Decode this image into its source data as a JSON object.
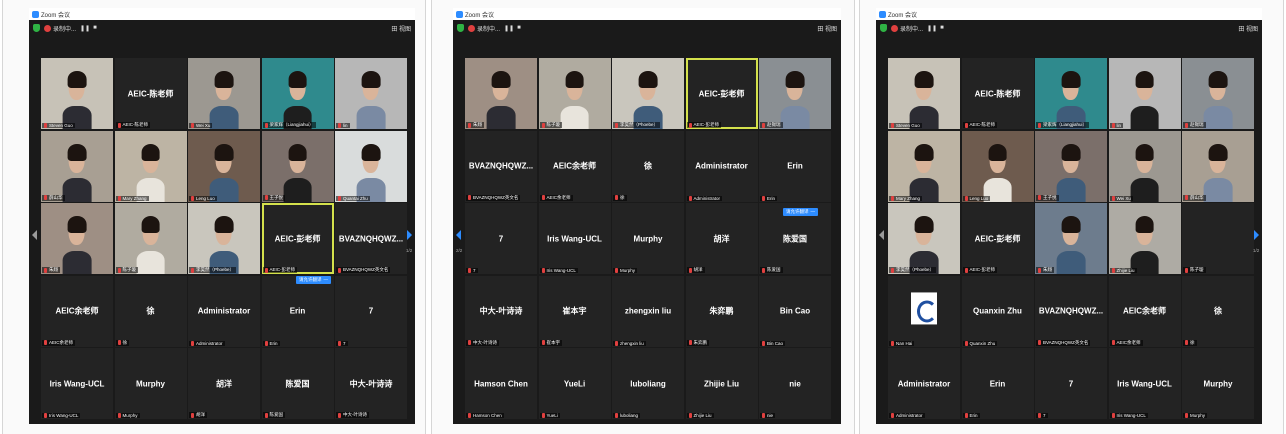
{
  "windows": [
    {
      "title": "Zoom 会议",
      "record_label": "录制中...",
      "view_label": "田 视图",
      "page": "1/2",
      "cc_label": "请允许翻译",
      "tiles": [
        {
          "kind": "video",
          "big": "",
          "label": "Steven Guo",
          "bg": "#c7c2b7"
        },
        {
          "kind": "name",
          "big": "AEIC-陈老师",
          "label": "AEIC-陈老师"
        },
        {
          "kind": "video",
          "big": "",
          "label": "Wei Xu",
          "bg": "#9c9891"
        },
        {
          "kind": "video",
          "big": "",
          "label": "梁家辉（Liangjiahui）",
          "bg": "#2f8a8d"
        },
        {
          "kind": "video",
          "big": "",
          "label": "lin",
          "bg": "#b7b7b7"
        },
        {
          "kind": "video",
          "big": "",
          "label": "薛山华",
          "bg": "#a89f93"
        },
        {
          "kind": "video",
          "big": "",
          "label": "Mary Zhang",
          "bg": "#bdb4a4"
        },
        {
          "kind": "video",
          "big": "",
          "label": "Leng Luo",
          "bg": "#6e5b4e"
        },
        {
          "kind": "video",
          "big": "",
          "label": "王子悦",
          "bg": "#7b6f6a"
        },
        {
          "kind": "video",
          "big": "",
          "label": "Quantai Zhu",
          "bg": "#d9dcdc"
        },
        {
          "kind": "video",
          "big": "",
          "label": "朱翔",
          "bg": "#9e8f84"
        },
        {
          "kind": "video",
          "big": "",
          "label": "陈子璇",
          "bg": "#b0aba0"
        },
        {
          "kind": "video",
          "big": "",
          "label": "李昊然（Phoebe）",
          "bg": "#c9c6bd"
        },
        {
          "kind": "name",
          "big": "AEIC-彭老师",
          "label": "AEIC-彭老师",
          "active": true
        },
        {
          "kind": "name",
          "big": "BVAZNQHQWZ...",
          "label": "BVAZNQHQWZ英文名"
        },
        {
          "kind": "name",
          "big": "AEIC余老师",
          "label": "AEIC余老师"
        },
        {
          "kind": "name",
          "big": "徐",
          "label": "徐"
        },
        {
          "kind": "name",
          "big": "Administrator",
          "label": "Administrator"
        },
        {
          "kind": "name",
          "big": "Erin",
          "label": "Erin"
        },
        {
          "kind": "name",
          "big": "7",
          "label": "7"
        },
        {
          "kind": "name",
          "big": "Iris Wang-UCL",
          "label": "Iris Wang-UCL"
        },
        {
          "kind": "name",
          "big": "Murphy",
          "label": "Murphy"
        },
        {
          "kind": "name",
          "big": "胡洋",
          "label": "胡洋"
        },
        {
          "kind": "name",
          "big": "陈爱国",
          "label": "陈爱国"
        },
        {
          "kind": "name",
          "big": "中大-叶诗诗",
          "label": "中大-叶诗诗"
        }
      ]
    },
    {
      "title": "Zoom 会议",
      "record_label": "录制中...",
      "view_label": "田 视图",
      "page": "2/2",
      "cc_label": "请允许翻译",
      "tiles": [
        {
          "kind": "video",
          "big": "",
          "label": "朱翔",
          "bg": "#9e8f84"
        },
        {
          "kind": "video",
          "big": "",
          "label": "陈子璇",
          "bg": "#b0aba0"
        },
        {
          "kind": "video",
          "big": "",
          "label": "李昊然（Phoebe）",
          "bg": "#c9c6bd"
        },
        {
          "kind": "name",
          "big": "AEIC-彭老师",
          "label": "AEIC-彭老师",
          "active": true
        },
        {
          "kind": "video",
          "big": "",
          "label": "赵锡瑞",
          "bg": "#8a8f93"
        },
        {
          "kind": "name",
          "big": "BVAZNQHQWZ...",
          "label": "BVAZNQHQWZ英文名"
        },
        {
          "kind": "name",
          "big": "AEIC余老师",
          "label": "AEIC余老师"
        },
        {
          "kind": "name",
          "big": "徐",
          "label": "徐"
        },
        {
          "kind": "name",
          "big": "Administrator",
          "label": "Administrator"
        },
        {
          "kind": "name",
          "big": "Erin",
          "label": "Erin"
        },
        {
          "kind": "name",
          "big": "7",
          "label": "7"
        },
        {
          "kind": "name",
          "big": "Iris Wang-UCL",
          "label": "Iris Wang-UCL"
        },
        {
          "kind": "name",
          "big": "Murphy",
          "label": "Murphy"
        },
        {
          "kind": "name",
          "big": "胡洋",
          "label": "胡洋"
        },
        {
          "kind": "name",
          "big": "陈爱国",
          "label": "陈爱国"
        },
        {
          "kind": "name",
          "big": "中大-叶诗诗",
          "label": "中大-叶诗诗"
        },
        {
          "kind": "name",
          "big": "崔本宇",
          "label": "崔本宇"
        },
        {
          "kind": "name",
          "big": "zhengxin liu",
          "label": "zhengxin liu"
        },
        {
          "kind": "name",
          "big": "朱弈鹏",
          "label": "朱弈鹏"
        },
        {
          "kind": "name",
          "big": "Bin Cao",
          "label": "Bin Cao"
        },
        {
          "kind": "name",
          "big": "Hamson Chen",
          "label": "Hamson Chen"
        },
        {
          "kind": "name",
          "big": "YueLi",
          "label": "YueLi"
        },
        {
          "kind": "name",
          "big": "luboliang",
          "label": "luboliang"
        },
        {
          "kind": "name",
          "big": "Zhijie Liu",
          "label": "Zhijie Liu"
        },
        {
          "kind": "name",
          "big": "nie",
          "label": "nie"
        }
      ]
    },
    {
      "title": "Zoom 会议",
      "record_label": "录制中...",
      "view_label": "田 视图",
      "page": "1/2",
      "cc_label": "",
      "tiles": [
        {
          "kind": "video",
          "big": "",
          "label": "Steven Guo",
          "bg": "#c7c2b7",
          "active": true
        },
        {
          "kind": "name",
          "big": "AEIC-陈老师",
          "label": "AEIC-陈老师"
        },
        {
          "kind": "video",
          "big": "",
          "label": "梁家辉（Liangjiahui）",
          "bg": "#2f8a8d"
        },
        {
          "kind": "video",
          "big": "",
          "label": "lin",
          "bg": "#b7b7b7"
        },
        {
          "kind": "video",
          "big": "",
          "label": "赵锡瑞",
          "bg": "#8a8f93"
        },
        {
          "kind": "video",
          "big": "",
          "label": "Mary Zhang",
          "bg": "#bdb4a4"
        },
        {
          "kind": "video",
          "big": "",
          "label": "Leng Luo",
          "bg": "#6e5b4e"
        },
        {
          "kind": "video",
          "big": "",
          "label": "王子悦",
          "bg": "#7b6f6a"
        },
        {
          "kind": "video",
          "big": "",
          "label": "Wei Xu",
          "bg": "#9c9891"
        },
        {
          "kind": "video",
          "big": "",
          "label": "薛山华",
          "bg": "#a89f93"
        },
        {
          "kind": "video",
          "big": "",
          "label": "李昊然（Phoebe）",
          "bg": "#c9c6bd"
        },
        {
          "kind": "name",
          "big": "AEIC-彭老师",
          "label": "AEIC-彭老师"
        },
        {
          "kind": "video",
          "big": "",
          "label": "朱翔",
          "bg": "#6d7c8d"
        },
        {
          "kind": "video",
          "big": "",
          "label": "Zhijie Liu",
          "bg": "#aeaba4"
        },
        {
          "kind": "name",
          "big": "",
          "label": "陈子璇"
        },
        {
          "kind": "logo",
          "big": "",
          "label": "Nan Hai"
        },
        {
          "kind": "name",
          "big": "Quanxin Zhu",
          "label": "Quanxin Zhu"
        },
        {
          "kind": "name",
          "big": "BVAZNQHQWZ...",
          "label": "BVAZNQHQWZ英文名"
        },
        {
          "kind": "name",
          "big": "AEIC余老师",
          "label": "AEIC余老师"
        },
        {
          "kind": "name",
          "big": "徐",
          "label": "徐"
        },
        {
          "kind": "name",
          "big": "Administrator",
          "label": "Administrator"
        },
        {
          "kind": "name",
          "big": "Erin",
          "label": "Erin"
        },
        {
          "kind": "name",
          "big": "7",
          "label": "7"
        },
        {
          "kind": "name",
          "big": "Iris Wang-UCL",
          "label": "Iris Wang-UCL"
        },
        {
          "kind": "name",
          "big": "Murphy",
          "label": "Murphy"
        }
      ]
    }
  ],
  "colors": {
    "accent": "#2d8cff",
    "active": "#d4e14c",
    "mute": "#e0403f",
    "tile": "#232323"
  }
}
